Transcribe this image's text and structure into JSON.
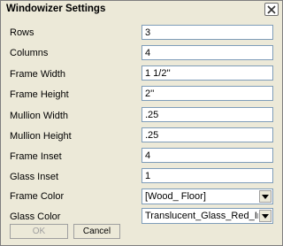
{
  "window": {
    "title": "Windowizer Settings"
  },
  "fields": [
    {
      "label": "Rows",
      "value": "3"
    },
    {
      "label": "Columns",
      "value": "4"
    },
    {
      "label": "Frame Width",
      "value": "1 1/2''"
    },
    {
      "label": "Frame Height",
      "value": "2''"
    },
    {
      "label": "Mullion Width",
      "value": ".25"
    },
    {
      "label": "Mullion Height",
      "value": ".25"
    },
    {
      "label": "Frame Inset",
      "value": "4"
    },
    {
      "label": "Glass Inset",
      "value": "1"
    }
  ],
  "selects": [
    {
      "label": "Frame Color",
      "value": "[Wood_ Floor]"
    },
    {
      "label": "Glass Color",
      "value": "Translucent_Glass_Red_Indi"
    }
  ],
  "buttons": {
    "ok_label": "OK",
    "cancel_label": "Cancel",
    "ok_enabled": false
  },
  "icons": {
    "close": "close-icon",
    "dropdown": "chevron-down-icon"
  },
  "colors": {
    "dialog_bg": "#ece9d8",
    "field_border": "#7f9db9",
    "disabled_text": "#a0a0a0"
  }
}
